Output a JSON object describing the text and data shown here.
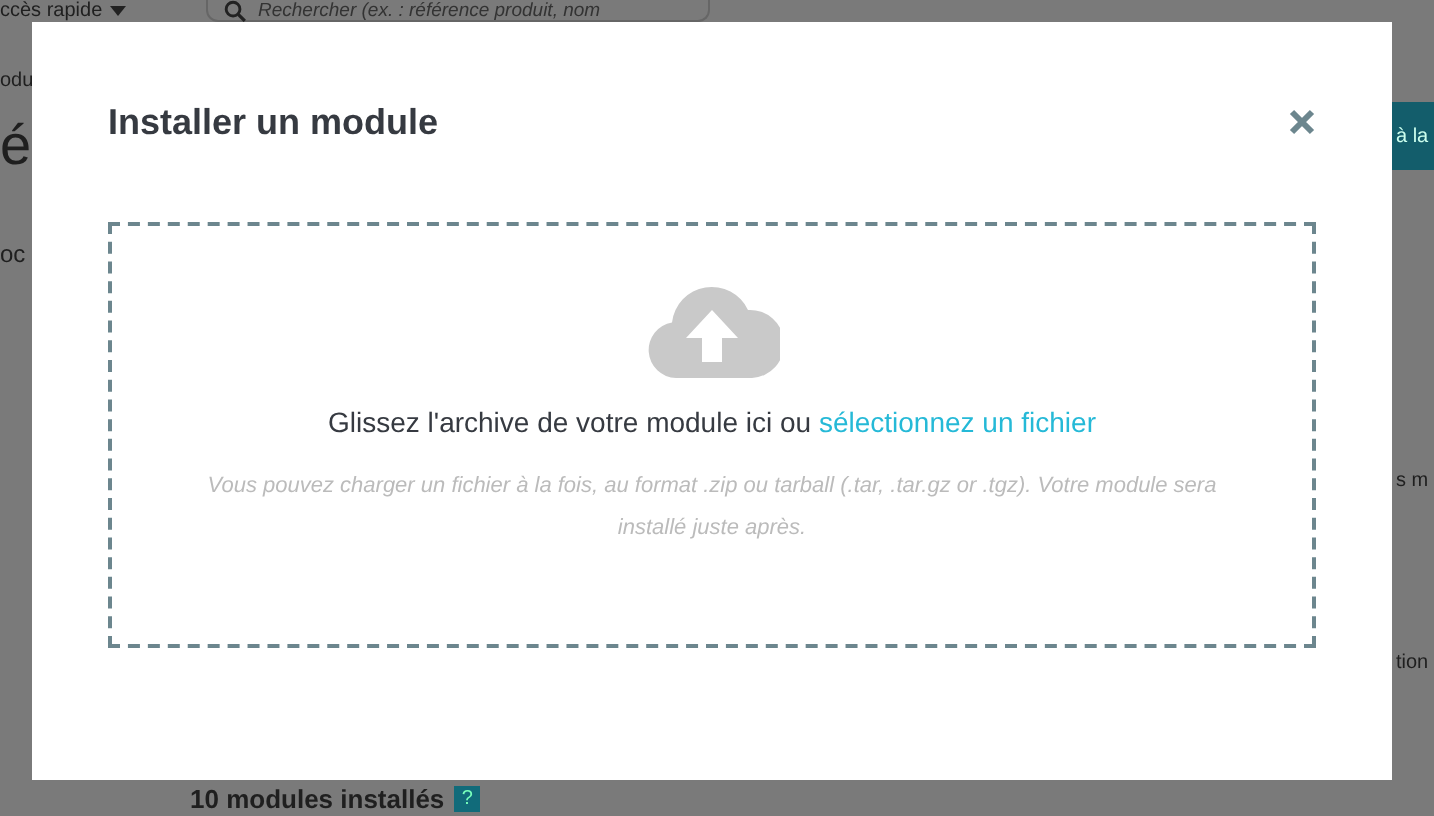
{
  "top_bar": {
    "quick_access": "ccès rapide",
    "search": {
      "placeholder": "Rechercher (ex. : référence produit, nom"
    }
  },
  "background": {
    "breadcrumb_fragment": "odu",
    "page_title_fragment": "é",
    "tab_fragment": "oc",
    "header_button": "à la",
    "row_fragments": [
      "s m",
      "tion"
    ],
    "installed_count": "10 modules installés",
    "help_badge": "?"
  },
  "modal": {
    "title": "Installer un module",
    "drop_text": "Glissez l'archive de votre module ici ou ",
    "drop_link": "sélectionnez un fichier",
    "hint": "Vous pouvez charger un fichier à la fois, au format .zip ou tarball (.tar, .tar.gz or .tgz). Votre module sera installé juste après."
  }
}
